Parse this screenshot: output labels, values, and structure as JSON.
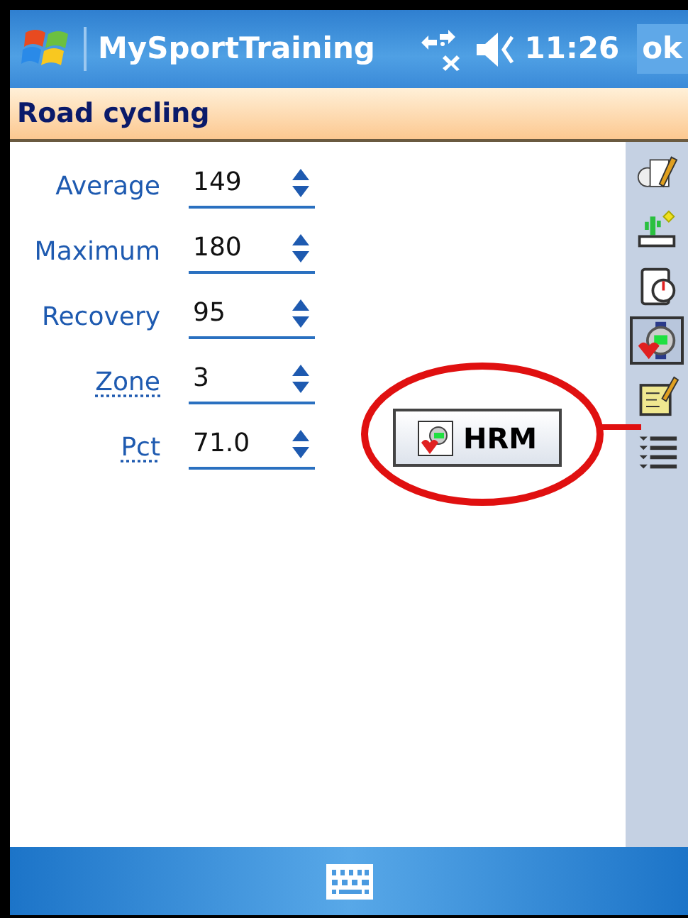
{
  "title_bar": {
    "title": "MySportTraining",
    "time": "11:26",
    "ok_button": "ok"
  },
  "header": {
    "title": "Road cycling"
  },
  "fields": [
    {
      "label": "Average",
      "value": "149",
      "kind": "plain"
    },
    {
      "label": "Maximum",
      "value": "180",
      "kind": "plain"
    },
    {
      "label": "Recovery",
      "value": "95",
      "kind": "plain"
    },
    {
      "label": "Zone",
      "value": "3",
      "kind": "link"
    },
    {
      "label": "Pct",
      "value": "71.0",
      "kind": "link"
    }
  ],
  "hrm_button": {
    "label": "HRM",
    "highlighted": true
  },
  "sidebar": {
    "items": [
      {
        "selected": false
      },
      {
        "selected": false
      },
      {
        "selected": false
      },
      {
        "selected": true
      },
      {
        "selected": false
      },
      {
        "selected": false
      }
    ]
  }
}
